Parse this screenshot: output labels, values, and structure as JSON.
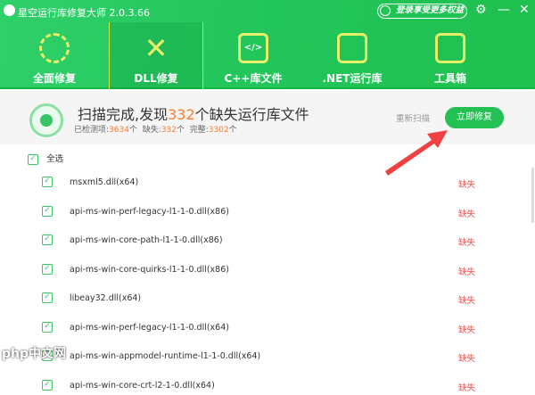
{
  "app": {
    "title": "星空运行库修复大师 2.0.3.66",
    "login": "登录享受更多权益"
  },
  "tabs": [
    {
      "label": "全面修复"
    },
    {
      "label": "DLL修复"
    },
    {
      "label": "C++库文件"
    },
    {
      "label": ".NET运行库"
    },
    {
      "label": "工具箱"
    }
  ],
  "scan": {
    "prefix": "扫描完成,发现",
    "count": "332",
    "suffix": "个缺失运行库文件",
    "detected_label": "已检测项:",
    "detected": "3634",
    "missing_label": "缺失:",
    "missing": "332",
    "complete_label": "完整:",
    "complete": "3302",
    "unit": "个",
    "rescan": "重新扫描",
    "fix": "立即修复"
  },
  "select_all": "全选",
  "rows": [
    {
      "name": "msxml5.dll(x64)",
      "status": "缺失"
    },
    {
      "name": "api-ms-win-perf-legacy-l1-1-0.dll(x86)",
      "status": "缺失"
    },
    {
      "name": "api-ms-win-core-path-l1-1-0.dll(x86)",
      "status": "缺失"
    },
    {
      "name": "api-ms-win-core-quirks-l1-1-0.dll(x86)",
      "status": "缺失"
    },
    {
      "name": "libeay32.dll(x64)",
      "status": "缺失"
    },
    {
      "name": "api-ms-win-perf-legacy-l1-1-0.dll(x64)",
      "status": "缺失"
    },
    {
      "name": "api-ms-win-appmodel-runtime-l1-1-0.dll(x64)",
      "status": "缺失"
    },
    {
      "name": "api-ms-win-core-crt-l2-1-0.dll(x64)",
      "status": "缺失"
    }
  ],
  "watermark": "php中文网",
  "colors": {
    "brand": "#23c153",
    "missing": "#f05050",
    "highlight": "#ff7a2e",
    "arrow": "#f04040"
  }
}
